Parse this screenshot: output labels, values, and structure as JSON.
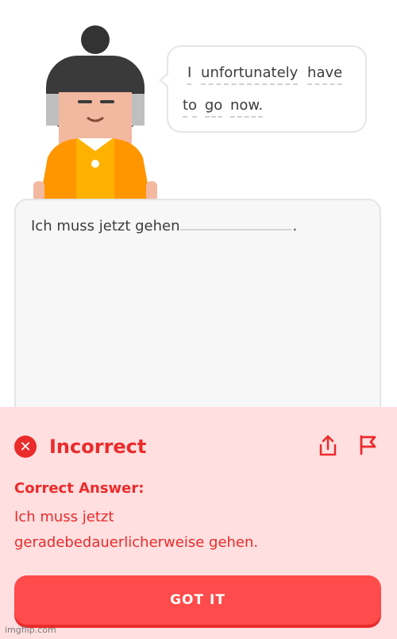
{
  "speech": {
    "line1": [
      "I",
      "unfortunately",
      "have"
    ],
    "line2": [
      "to",
      "go",
      "now."
    ]
  },
  "answer": {
    "prefix": "Ich muss jetzt gehen",
    "period": "."
  },
  "feedback": {
    "title": "Incorrect",
    "close_glyph": "✕",
    "correct_label": "Correct Answer:",
    "correct_line1": "Ich muss jetzt",
    "correct_line2": "geradebedauerlicherweise gehen.",
    "button": "GOT IT",
    "icons": [
      "share-icon",
      "flag-icon"
    ]
  },
  "colors": {
    "error": "#ea2b2b",
    "button": "#ff4b4b",
    "panel": "#ffdfe0",
    "shirt": "#ff9600"
  },
  "watermark": "imgflip.com"
}
